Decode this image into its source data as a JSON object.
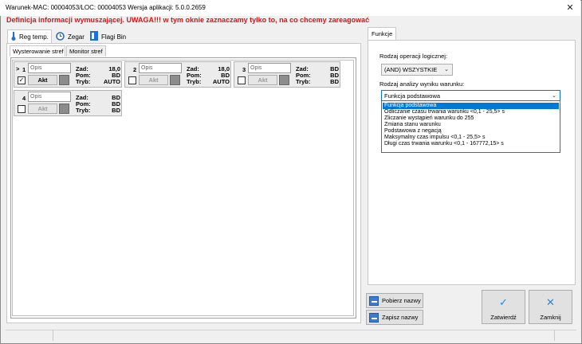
{
  "window": {
    "title": "Warunek-MAC: 00004053/LOC: 00004053 Wersja aplikacji: 5.0.0.2659",
    "warning": "Definicja informacji wymuszającej. UWAGA!!! w tym oknie zaznaczamy tylko to, na co chcemy zareagować",
    "close_glyph": "✕"
  },
  "tabs": [
    {
      "label": "Reg temp.",
      "icon": "thermometer-icon",
      "icon_color": "#1e6fd9"
    },
    {
      "label": "Zegar",
      "icon": "clock-icon",
      "icon_color": "#1e6fd9"
    },
    {
      "label": "Flagi Bin",
      "icon": "flag-icon",
      "icon_color": "#1e6fd9"
    }
  ],
  "subtabs": [
    "Wysterowanie stref",
    "Monitor stref"
  ],
  "zones": [
    {
      "marker": ">",
      "num": "1",
      "opis_placeholder": "Opis",
      "akt": "Akt",
      "checked": "✓",
      "zad_label": "Zad:",
      "pom_label": "Pom:",
      "tryb_label": "Tryb:",
      "zad": "18,0",
      "pom": "BD",
      "tryb": "AUTO"
    },
    {
      "marker": "",
      "num": "2",
      "opis_placeholder": "Opis",
      "akt": "Akt",
      "checked": "",
      "zad_label": "Zad:",
      "pom_label": "Pom:",
      "tryb_label": "Tryb:",
      "zad": "18,0",
      "pom": "BD",
      "tryb": "AUTO"
    },
    {
      "marker": "",
      "num": "3",
      "opis_placeholder": "Opis",
      "akt": "Akt",
      "checked": "",
      "zad_label": "Zad:",
      "pom_label": "Pom:",
      "tryb_label": "Tryb:",
      "zad": "BD",
      "pom": "BD",
      "tryb": "BD"
    },
    {
      "marker": "",
      "num": "4",
      "opis_placeholder": "Opis",
      "akt": "Akt",
      "checked": "",
      "zad_label": "Zad:",
      "pom_label": "Pom:",
      "tryb_label": "Tryb:",
      "zad": "BD",
      "pom": "BD",
      "tryb": "BD"
    }
  ],
  "right": {
    "tab": "Funkcje",
    "logic_label": "Rodzaj operacji logicznej:",
    "logic_value": "(AND) WSZYSTKIE",
    "analysis_label": "Rodzaj analizy wyniku warunku:",
    "analysis_value": "Funkcja podstawowa",
    "options": [
      "Funkcja podstawowa",
      "Odliczanie czasu trwania warunku <0,1 - 25,5> s",
      "Zliczanie wystąpień warunku do 255",
      "Zmiana stanu warunku",
      "Podstawowa z negacją",
      "Maksymalny czas impulsu <0,1 - 25,5> s",
      "Długi czas trwania warunku <0,1 - 167772,15> s"
    ]
  },
  "buttons": {
    "pobierz": "Pobierz nazwy",
    "zapisz": "Zapisz nazwy",
    "zatwierdz": "Zatwierdź",
    "zatwierdz_glyph": "✓",
    "zamknij": "Zamknij",
    "zamknij_glyph": "✕"
  },
  "colors": {
    "warning": "#e01010",
    "accent": "#0078d7"
  }
}
